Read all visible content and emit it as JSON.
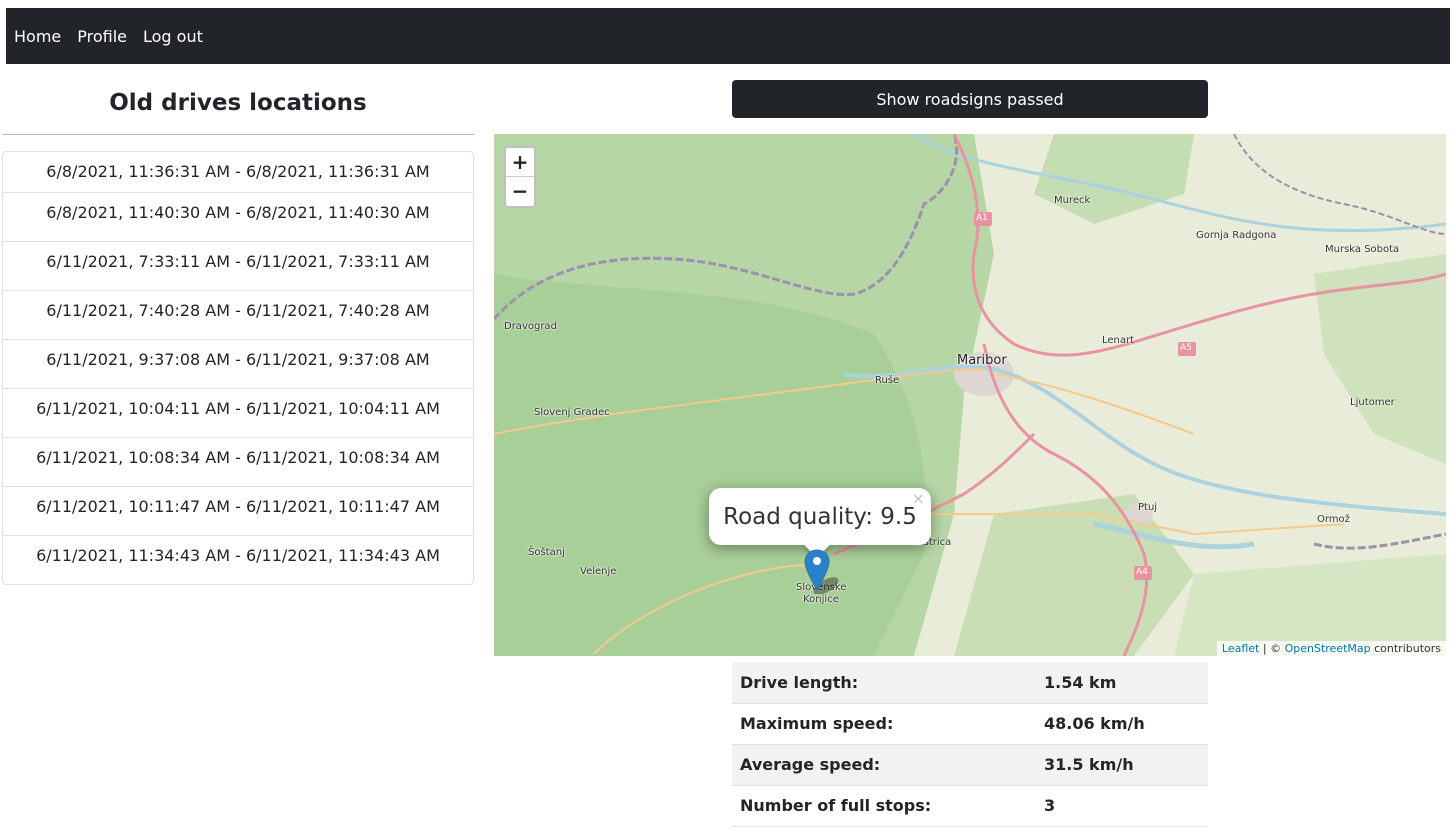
{
  "nav": {
    "home": "Home",
    "profile": "Profile",
    "logout": "Log out"
  },
  "sidebar": {
    "title": "Old drives locations",
    "drives": [
      "6/8/2021, 11:36:31 AM - 6/8/2021, 11:36:31 AM",
      "6/8/2021, 11:40:30 AM - 6/8/2021, 11:40:30 AM",
      "6/11/2021, 7:33:11 AM - 6/11/2021, 7:33:11 AM",
      "6/11/2021, 7:40:28 AM - 6/11/2021, 7:40:28 AM",
      "6/11/2021, 9:37:08 AM - 6/11/2021, 9:37:08 AM",
      "6/11/2021, 10:04:11 AM - 6/11/2021, 10:04:11 AM",
      "6/11/2021, 10:08:34 AM - 6/11/2021, 10:08:34 AM",
      "6/11/2021, 10:11:47 AM - 6/11/2021, 10:11:47 AM",
      "6/11/2021, 11:34:43 AM - 6/11/2021, 11:34:43 AM"
    ]
  },
  "roadsigns_button": "Show roadsigns passed",
  "map": {
    "zoom_in": "+",
    "zoom_out": "−",
    "popup_text": "Road quality: 9.5",
    "popup_close": "×",
    "places": {
      "mureck": "Mureck",
      "gornja_radgona": "Gornja Radgona",
      "murska_sobota": "Murska Sobota",
      "dravograd": "Dravograd",
      "maribor": "Maribor",
      "ruse": "Ruše",
      "lenart": "Lenart",
      "slovenj_gradec": "Slovenj Gradec",
      "ljutomer": "Ljutomer",
      "ptuj": "Ptuj",
      "ormoz": "Ormož",
      "sostanj": "Šoštanj",
      "velenje": "Velenje",
      "slovenske_konjice": "Slovenske Konjice",
      "bistrica": "Bistrica"
    },
    "road_labels": {
      "a1": "A1",
      "a5": "A5",
      "a4": "A4"
    },
    "attribution": {
      "leaflet": "Leaflet",
      "sep": " | © ",
      "osm": "OpenStreetMap",
      "tail": " contributors"
    }
  },
  "stats": [
    {
      "label": "Drive length:",
      "value": "1.54 km"
    },
    {
      "label": "Maximum speed:",
      "value": "48.06 km/h"
    },
    {
      "label": "Average speed:",
      "value": "31.5 km/h"
    },
    {
      "label": "Number of full stops:",
      "value": "3"
    }
  ],
  "colors": {
    "navbar": "#212529",
    "map_forest": "#add19e",
    "map_land": "#e8ead6",
    "highway": "#e892a2",
    "border": "#9e8fb0",
    "marker": "#2a81cb"
  }
}
